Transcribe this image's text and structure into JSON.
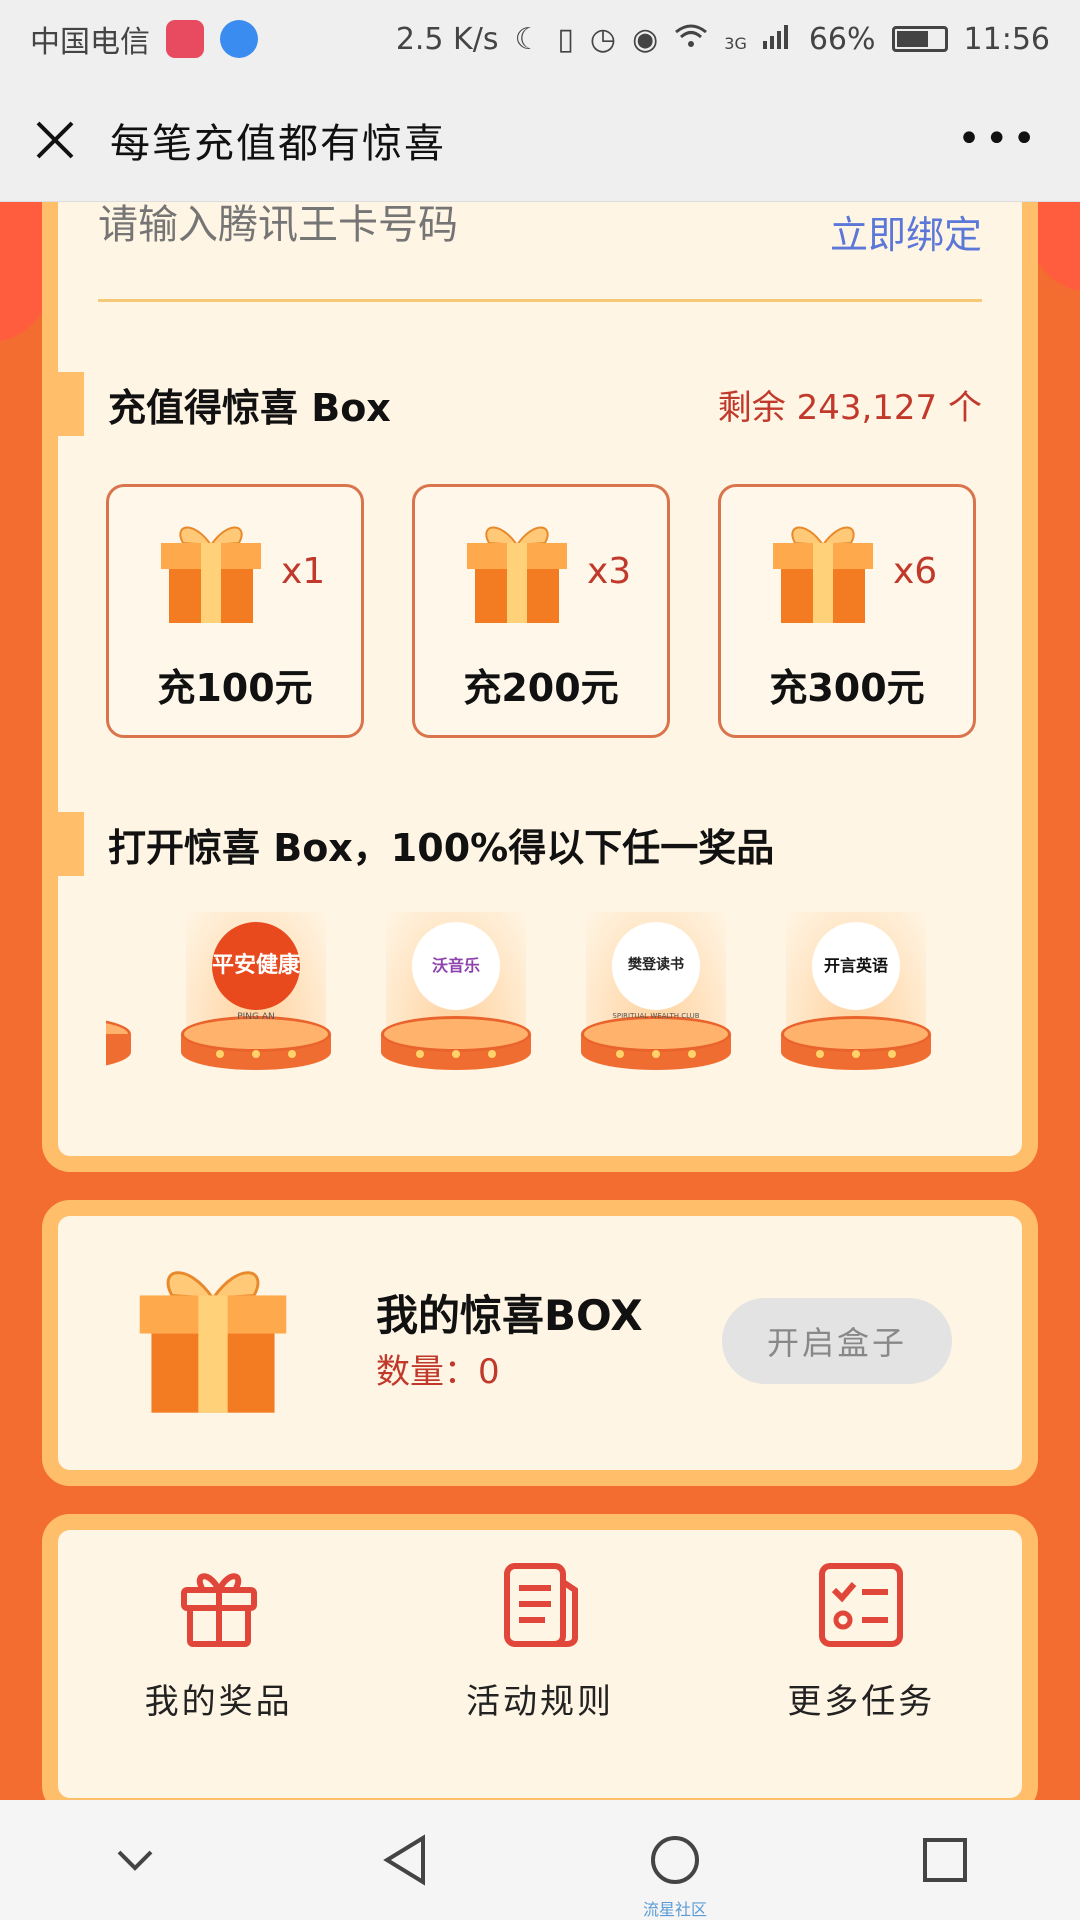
{
  "status_bar": {
    "carrier": "中国电信",
    "net_speed": "2.5 K/s",
    "network": "3G",
    "battery": "66%",
    "time": "11:56"
  },
  "title_bar": {
    "title": "每笔充值都有惊喜",
    "more": "•••"
  },
  "bind": {
    "placeholder": "请输入腾讯王卡号码",
    "button": "立即绑定"
  },
  "recharge_section": {
    "title": "充值得惊喜 Box",
    "remaining": "剩余 243,127 个",
    "tiers": [
      {
        "multiplier": "x1",
        "label": "充100元"
      },
      {
        "multiplier": "x3",
        "label": "充200元"
      },
      {
        "multiplier": "x6",
        "label": "充300元"
      }
    ]
  },
  "prize_section": {
    "title": "打开惊喜 Box，100%得以下任一奖品",
    "prizes": [
      {
        "name": "平安健康",
        "sub": "PING AN"
      },
      {
        "name": "沃音乐",
        "sub": ""
      },
      {
        "name": "樊登读书",
        "sub": "SPIRITUAL WEALTH CLUB"
      },
      {
        "name": "开言英语",
        "sub": ""
      }
    ]
  },
  "my_box": {
    "title": "我的惊喜BOX",
    "count": "数量：0",
    "open_button": "开启盒子"
  },
  "actions": [
    {
      "label": "我的奖品",
      "icon": "gift-icon"
    },
    {
      "label": "活动规则",
      "icon": "document-icon"
    },
    {
      "label": "更多任务",
      "icon": "checklist-icon"
    }
  ],
  "nav": {
    "caption": "流星社区"
  },
  "colors": {
    "background": "#f26d2f",
    "card_border": "#ffbe6a",
    "card_bg": "#fff5e4",
    "accent_red": "#c0392b",
    "link_blue": "#5b78d8"
  }
}
